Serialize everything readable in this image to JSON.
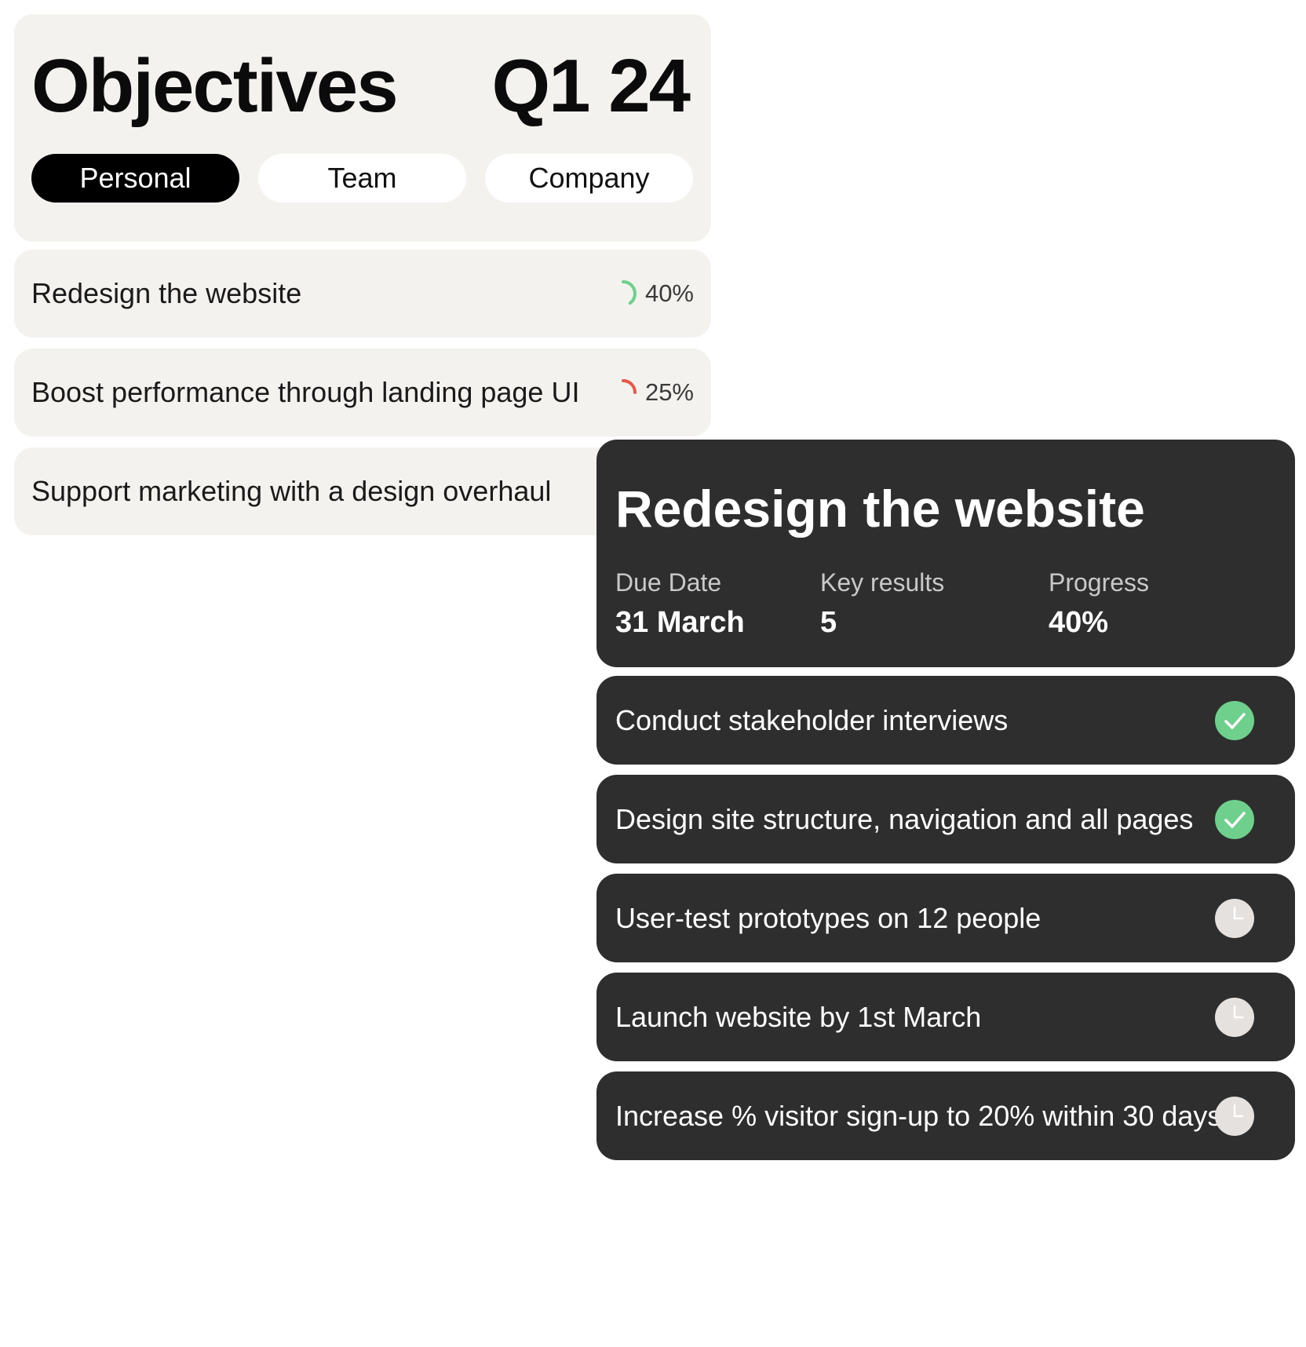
{
  "colors": {
    "card_light": "#f4f2ee",
    "card_dark": "#2e2e2e",
    "tab_active": "#000000",
    "progress_green": "#6fcf8c",
    "progress_red": "#e8574a",
    "done_green": "#6fcf8c",
    "pending_grey": "#e4e1de"
  },
  "header": {
    "title": "Objectives",
    "quarter": "Q1 24",
    "tabs": [
      {
        "label": "Personal",
        "active": true
      },
      {
        "label": "Team",
        "active": false
      },
      {
        "label": "Company",
        "active": false
      }
    ]
  },
  "objectives": [
    {
      "label": "Redesign the website",
      "progress_text": "40%",
      "progress": 0.4,
      "color": "#6fcf8c"
    },
    {
      "label": "Boost performance through landing page UI",
      "progress_text": "25%",
      "progress": 0.25,
      "color": "#e8574a"
    },
    {
      "label": "Support marketing with a design overhaul",
      "progress_text": "",
      "progress": null,
      "color": ""
    }
  ],
  "detail": {
    "title": "Redesign the website",
    "stats": [
      {
        "label": "Due Date",
        "value": "31 March"
      },
      {
        "label": "Key results",
        "value": "5"
      },
      {
        "label": "Progress",
        "value": "40%"
      }
    ],
    "key_results": [
      {
        "label": "Conduct stakeholder interviews",
        "status": "done",
        "icon": "check-circle-icon"
      },
      {
        "label": "Design site structure, navigation and all pages",
        "status": "done",
        "icon": "check-circle-icon"
      },
      {
        "label": "User-test prototypes on 12 people",
        "status": "pending",
        "icon": "clock-icon"
      },
      {
        "label": "Launch website by 1st March",
        "status": "pending",
        "icon": "clock-icon"
      },
      {
        "label": "Increase % visitor sign-up to 20% within 30 days",
        "status": "pending",
        "icon": "clock-icon"
      }
    ]
  }
}
